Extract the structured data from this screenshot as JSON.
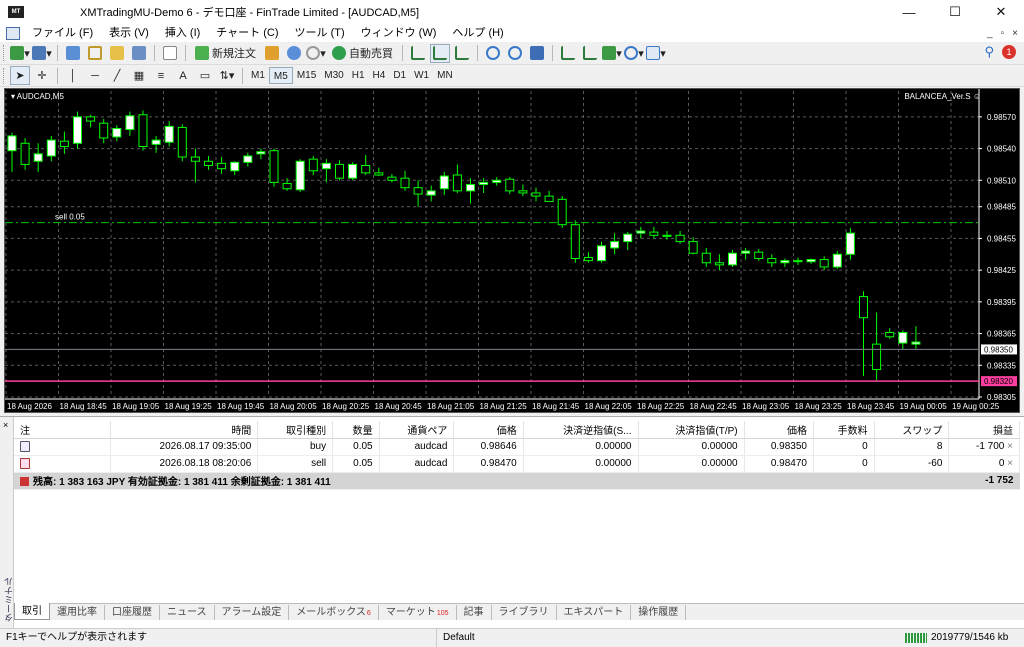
{
  "window": {
    "title": "XMTradingMU-Demo 6 - デモ口座 - FinTrade Limited - [AUDCAD,M5]",
    "controls": [
      "—",
      "☐",
      "✕"
    ]
  },
  "menu": {
    "items": [
      "ファイル (F)",
      "表示 (V)",
      "挿入 (I)",
      "チャート (C)",
      "ツール (T)",
      "ウィンドウ (W)",
      "ヘルプ (H)"
    ],
    "mdi_controls": [
      "_",
      "▫",
      "×"
    ]
  },
  "toolbar": {
    "new_order_label": "新規注文",
    "autotrade_label": "自動売買",
    "notification_count": "1",
    "timeframes": [
      "M1",
      "M5",
      "M15",
      "M30",
      "H1",
      "H4",
      "D1",
      "W1",
      "MN"
    ],
    "active_timeframe": "M5",
    "text_tool_label": "A"
  },
  "chart": {
    "symbol_label": "AUDCAD,M5",
    "ea_label": "BALANCEA_Ver.S ☺",
    "sell_line_label": "sell 0.05",
    "price_labels": [
      "0.98570",
      "0.98540",
      "0.98510",
      "0.98485",
      "0.98455",
      "0.98425",
      "0.98395",
      "0.98365",
      "0.98335",
      "0.98305"
    ],
    "bid_price": "0.98350",
    "ask_price": "0.98320",
    "time_labels": [
      "18 Aug 2026",
      "18 Aug 18:45",
      "18 Aug 19:05",
      "18 Aug 19:25",
      "18 Aug 19:45",
      "18 Aug 20:05",
      "18 Aug 20:25",
      "18 Aug 20:45",
      "18 Aug 21:05",
      "18 Aug 21:25",
      "18 Aug 21:45",
      "18 Aug 22:05",
      "18 Aug 22:25",
      "18 Aug 22:45",
      "18 Aug 23:05",
      "18 Aug 23:25",
      "18 Aug 23:45",
      "19 Aug 00:05",
      "19 Aug 00:25"
    ],
    "colors": {
      "background": "#000000",
      "bull": "#ffffff",
      "bear": "#000000",
      "outline": "#00ff00",
      "grid": "#5a5a5a",
      "ask_line": "#ff3f9f",
      "bid_line": "#808090",
      "sell_line": "#00c000"
    }
  },
  "chart_data": {
    "type": "candlestick",
    "y_range": [
      0.98305,
      0.98585
    ],
    "sell_level": 0.9847,
    "bid": 0.9835,
    "ask": 0.9832,
    "candles": [
      {
        "o": 0.98538,
        "h": 0.98555,
        "l": 0.98518,
        "c": 0.98552
      },
      {
        "o": 0.98545,
        "h": 0.9855,
        "l": 0.9852,
        "c": 0.98525
      },
      {
        "o": 0.98528,
        "h": 0.98545,
        "l": 0.98518,
        "c": 0.98535
      },
      {
        "o": 0.98533,
        "h": 0.98552,
        "l": 0.98528,
        "c": 0.98548
      },
      {
        "o": 0.98547,
        "h": 0.98556,
        "l": 0.98535,
        "c": 0.98542
      },
      {
        "o": 0.98545,
        "h": 0.98575,
        "l": 0.9854,
        "c": 0.9857
      },
      {
        "o": 0.9857,
        "h": 0.98572,
        "l": 0.9856,
        "c": 0.98566
      },
      {
        "o": 0.98564,
        "h": 0.98568,
        "l": 0.98545,
        "c": 0.9855
      },
      {
        "o": 0.98551,
        "h": 0.98562,
        "l": 0.98547,
        "c": 0.98559
      },
      {
        "o": 0.98558,
        "h": 0.98575,
        "l": 0.98552,
        "c": 0.98571
      },
      {
        "o": 0.98572,
        "h": 0.98576,
        "l": 0.98538,
        "c": 0.98542
      },
      {
        "o": 0.98544,
        "h": 0.98552,
        "l": 0.98536,
        "c": 0.98548
      },
      {
        "o": 0.98546,
        "h": 0.98566,
        "l": 0.98542,
        "c": 0.98561
      },
      {
        "o": 0.9856,
        "h": 0.98563,
        "l": 0.98528,
        "c": 0.98532
      },
      {
        "o": 0.98532,
        "h": 0.9854,
        "l": 0.98508,
        "c": 0.98528
      },
      {
        "o": 0.98528,
        "h": 0.98533,
        "l": 0.9852,
        "c": 0.98524
      },
      {
        "o": 0.98526,
        "h": 0.98532,
        "l": 0.98516,
        "c": 0.98521
      },
      {
        "o": 0.98519,
        "h": 0.98528,
        "l": 0.98515,
        "c": 0.98527
      },
      {
        "o": 0.98527,
        "h": 0.98536,
        "l": 0.98523,
        "c": 0.98533
      },
      {
        "o": 0.98535,
        "h": 0.9854,
        "l": 0.9853,
        "c": 0.98537
      },
      {
        "o": 0.98538,
        "h": 0.9854,
        "l": 0.98504,
        "c": 0.98508
      },
      {
        "o": 0.98507,
        "h": 0.98512,
        "l": 0.985,
        "c": 0.98502
      },
      {
        "o": 0.98501,
        "h": 0.9853,
        "l": 0.98499,
        "c": 0.98528
      },
      {
        "o": 0.9853,
        "h": 0.98533,
        "l": 0.98515,
        "c": 0.98519
      },
      {
        "o": 0.98521,
        "h": 0.9853,
        "l": 0.98508,
        "c": 0.98526
      },
      {
        "o": 0.98525,
        "h": 0.98529,
        "l": 0.9851,
        "c": 0.98512
      },
      {
        "o": 0.98512,
        "h": 0.98527,
        "l": 0.9851,
        "c": 0.98525
      },
      {
        "o": 0.98524,
        "h": 0.98534,
        "l": 0.98515,
        "c": 0.98517
      },
      {
        "o": 0.98517,
        "h": 0.98522,
        "l": 0.98514,
        "c": 0.98515
      },
      {
        "o": 0.98513,
        "h": 0.98516,
        "l": 0.98508,
        "c": 0.9851
      },
      {
        "o": 0.98512,
        "h": 0.98519,
        "l": 0.985,
        "c": 0.98503
      },
      {
        "o": 0.98503,
        "h": 0.9851,
        "l": 0.98485,
        "c": 0.98497
      },
      {
        "o": 0.98496,
        "h": 0.98505,
        "l": 0.9849,
        "c": 0.985
      },
      {
        "o": 0.98502,
        "h": 0.98518,
        "l": 0.98496,
        "c": 0.98514
      },
      {
        "o": 0.98515,
        "h": 0.98525,
        "l": 0.98498,
        "c": 0.985
      },
      {
        "o": 0.985,
        "h": 0.98512,
        "l": 0.98488,
        "c": 0.98506
      },
      {
        "o": 0.98506,
        "h": 0.98512,
        "l": 0.98498,
        "c": 0.98508
      },
      {
        "o": 0.98508,
        "h": 0.98513,
        "l": 0.98505,
        "c": 0.9851
      },
      {
        "o": 0.98511,
        "h": 0.98513,
        "l": 0.98497,
        "c": 0.985
      },
      {
        "o": 0.985,
        "h": 0.98506,
        "l": 0.98495,
        "c": 0.98498
      },
      {
        "o": 0.98498,
        "h": 0.98503,
        "l": 0.9849,
        "c": 0.98495
      },
      {
        "o": 0.98495,
        "h": 0.985,
        "l": 0.9849,
        "c": 0.9849
      },
      {
        "o": 0.98492,
        "h": 0.98495,
        "l": 0.98465,
        "c": 0.98468
      },
      {
        "o": 0.98468,
        "h": 0.98472,
        "l": 0.98432,
        "c": 0.98436
      },
      {
        "o": 0.98437,
        "h": 0.98442,
        "l": 0.98432,
        "c": 0.98434
      },
      {
        "o": 0.98434,
        "h": 0.98452,
        "l": 0.98432,
        "c": 0.98448
      },
      {
        "o": 0.98446,
        "h": 0.9846,
        "l": 0.9844,
        "c": 0.98452
      },
      {
        "o": 0.98452,
        "h": 0.98461,
        "l": 0.98444,
        "c": 0.98459
      },
      {
        "o": 0.9846,
        "h": 0.98466,
        "l": 0.98455,
        "c": 0.98462
      },
      {
        "o": 0.98461,
        "h": 0.98466,
        "l": 0.98455,
        "c": 0.98458
      },
      {
        "o": 0.98458,
        "h": 0.98462,
        "l": 0.98454,
        "c": 0.98457
      },
      {
        "o": 0.98458,
        "h": 0.98462,
        "l": 0.9845,
        "c": 0.98452
      },
      {
        "o": 0.98452,
        "h": 0.98456,
        "l": 0.9844,
        "c": 0.98441
      },
      {
        "o": 0.98441,
        "h": 0.98446,
        "l": 0.98428,
        "c": 0.98432
      },
      {
        "o": 0.98432,
        "h": 0.9844,
        "l": 0.98425,
        "c": 0.9843
      },
      {
        "o": 0.9843,
        "h": 0.98444,
        "l": 0.98428,
        "c": 0.98441
      },
      {
        "o": 0.98441,
        "h": 0.98446,
        "l": 0.98435,
        "c": 0.98443
      },
      {
        "o": 0.98442,
        "h": 0.98445,
        "l": 0.98434,
        "c": 0.98436
      },
      {
        "o": 0.98436,
        "h": 0.9844,
        "l": 0.98428,
        "c": 0.98432
      },
      {
        "o": 0.98432,
        "h": 0.98436,
        "l": 0.98428,
        "c": 0.98434
      },
      {
        "o": 0.98434,
        "h": 0.98437,
        "l": 0.9843,
        "c": 0.98433
      },
      {
        "o": 0.98433,
        "h": 0.98436,
        "l": 0.98431,
        "c": 0.98435
      },
      {
        "o": 0.98435,
        "h": 0.98438,
        "l": 0.98425,
        "c": 0.98428
      },
      {
        "o": 0.98428,
        "h": 0.98443,
        "l": 0.98426,
        "c": 0.9844
      },
      {
        "o": 0.9844,
        "h": 0.98465,
        "l": 0.98435,
        "c": 0.9846
      },
      {
        "o": 0.984,
        "h": 0.98405,
        "l": 0.98325,
        "c": 0.9838
      },
      {
        "o": 0.98355,
        "h": 0.98385,
        "l": 0.9832,
        "c": 0.98331
      },
      {
        "o": 0.98366,
        "h": 0.9837,
        "l": 0.9836,
        "c": 0.98362
      },
      {
        "o": 0.98356,
        "h": 0.98368,
        "l": 0.9835,
        "c": 0.98366
      },
      {
        "o": 0.98355,
        "h": 0.98372,
        "l": 0.9835,
        "c": 0.98357
      }
    ]
  },
  "orders": {
    "headers": [
      "注",
      "時間",
      "取引種別",
      "数量",
      "通貨ペア",
      "価格",
      "決済逆指値(S...",
      "決済指値(T/P)",
      "価格",
      "手数料",
      "スワップ",
      "損益"
    ],
    "rows": [
      {
        "type": "buy",
        "time": "2026.08.17 09:35:00",
        "kind": "buy",
        "volume": "0.05",
        "symbol": "audcad",
        "price": "0.98646",
        "sl": "0.00000",
        "tp": "0.00000",
        "current": "0.98350",
        "commission": "0",
        "swap": "8",
        "profit": "-1 700",
        "close": "×"
      },
      {
        "type": "sell",
        "time": "2026.08.18 08:20:06",
        "kind": "sell",
        "volume": "0.05",
        "symbol": "audcad",
        "price": "0.98470",
        "sl": "0.00000",
        "tp": "0.00000",
        "current": "0.98470",
        "commission": "0",
        "swap": "-60",
        "profit": "0",
        "close": "×"
      }
    ],
    "summary_text": "残高: 1 383 163 JPY  有効証拠金: 1 381 411  余剰証拠金: 1 381 411",
    "summary_total": "-1 752"
  },
  "terminal": {
    "close_glyph": "×",
    "side_label": "ターミナル",
    "tabs": [
      {
        "label": "取引",
        "count": ""
      },
      {
        "label": "運用比率",
        "count": ""
      },
      {
        "label": "口座履歴",
        "count": ""
      },
      {
        "label": "ニュース",
        "count": ""
      },
      {
        "label": "アラーム設定",
        "count": ""
      },
      {
        "label": "メールボックス",
        "count": "6"
      },
      {
        "label": "マーケット",
        "count": "105"
      },
      {
        "label": "記事",
        "count": ""
      },
      {
        "label": "ライブラリ",
        "count": ""
      },
      {
        "label": "エキスパート",
        "count": ""
      },
      {
        "label": "操作履歴",
        "count": ""
      }
    ],
    "active_tab": "取引"
  },
  "status": {
    "help": "F1キーでヘルプが表示されます",
    "profile": "Default",
    "traffic": "2019779/1546 kb"
  }
}
